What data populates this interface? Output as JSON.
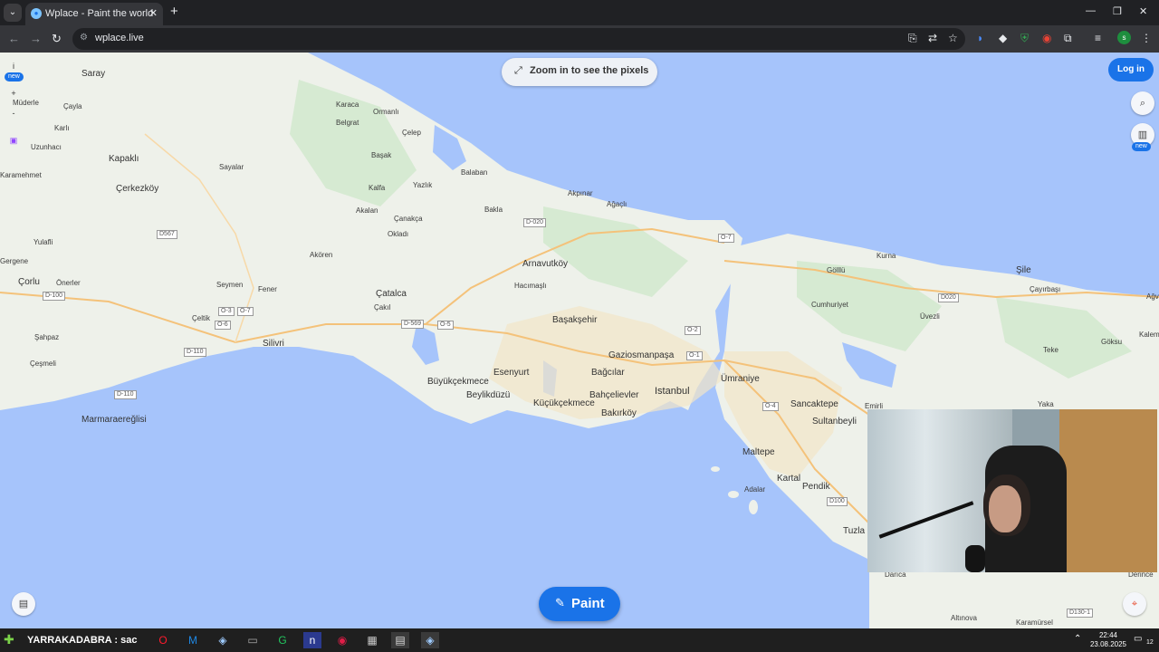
{
  "browser": {
    "tab_title": "Wplace - Paint the world",
    "url": "wplace.live",
    "profile_initial": "s"
  },
  "app": {
    "zoom_hint": "Zoom in to see the pixels",
    "login_label": "Log in",
    "paint_label": "Paint",
    "new_badge": "new",
    "info_label": "i"
  },
  "map": {
    "cities": [
      "Saray",
      "Kapaklı",
      "Çerkezköy",
      "Çorlu",
      "Silivri",
      "Çatalca",
      "Arnavutköy",
      "Başakşehir",
      "Esenyurt",
      "Büyükçekmece",
      "Beylikdüzü",
      "Küçükçekmece",
      "Bağcılar",
      "Bahçelievler",
      "Bakırköy",
      "Gaziosmanpaşa",
      "Istanbul",
      "Ümraniye",
      "Sancaktepe",
      "Sultanbeyli",
      "Maltepe",
      "Kartal",
      "Pendik",
      "Marmaraereğlisi",
      "Şile",
      "Tuzla"
    ],
    "places": [
      "Karaca",
      "Belgrat",
      "Ormanlı",
      "Çelep",
      "Başak",
      "Balaban",
      "Kalfa",
      "Yazlık",
      "Akpınar",
      "Ağaçlı",
      "Bakla",
      "Akalan",
      "Çanakça",
      "Okladı",
      "Akören",
      "Seymen",
      "Fener",
      "Çakıl",
      "Çeltik",
      "Şahpaz",
      "Yulafli",
      "Önerler",
      "Uzunhacı",
      "Karlı",
      "Çayla",
      "Sayalar",
      "Karamehmet",
      "Çeşmeli",
      "Hacımaşlı",
      "Gölllü",
      "Kurna",
      "Cumhuriyet",
      "Üvezli",
      "Çayırbaşı",
      "Göksu",
      "Teke",
      "Yaka",
      "Emirli",
      "Adalar",
      "Darıca",
      "Altınova",
      "Karamürsel",
      "Derince",
      "Kalem",
      "Ağva",
      "Gergene",
      "Müderle"
    ],
    "roads": [
      "D567",
      "D-100",
      "O-3",
      "O-7",
      "O-6",
      "D-110",
      "D-569",
      "O-5",
      "D-020",
      "O-7",
      "O-2",
      "O-4",
      "D020",
      "O-1",
      "D100",
      "D130-1",
      "D-110"
    ]
  },
  "webcam": {
    "description": ""
  },
  "taskbar": {
    "ticker_user": "YARRAKADABRA",
    "ticker_text": ": sac",
    "time": "22:44",
    "date": "23.08.2025",
    "notification_count": "12"
  },
  "colors": {
    "water": "#a6c4fb",
    "land": "#eef1ea",
    "accent": "#1a73e8",
    "chrome_dark": "#202124"
  }
}
